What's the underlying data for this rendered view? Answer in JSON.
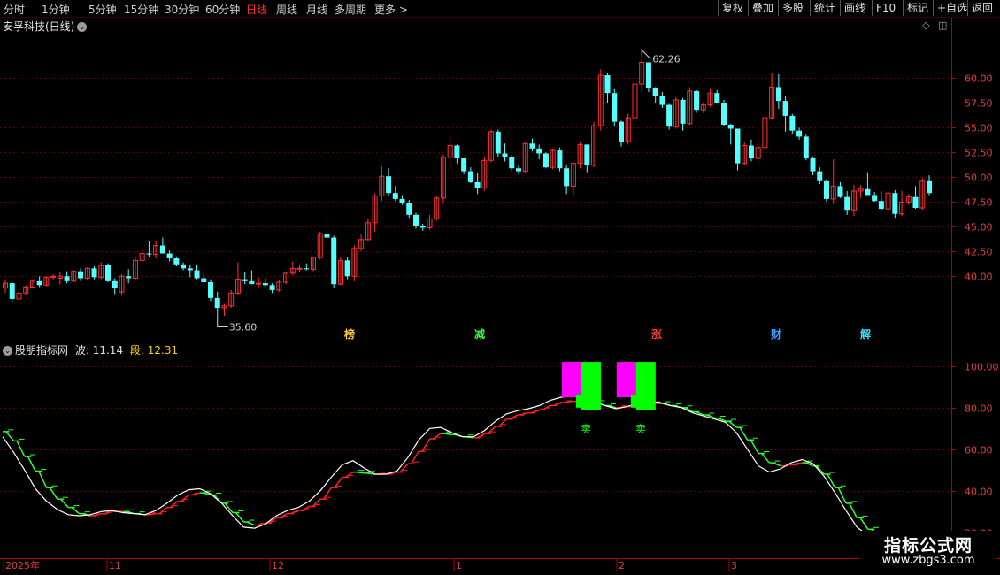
{
  "toolbar": {
    "timeframes": [
      "分时",
      "1分钟",
      "5分钟",
      "15分钟",
      "30分钟",
      "60分钟",
      "日线",
      "周线",
      "月线",
      "多周期",
      "更多 >"
    ],
    "active_timeframe": "日线",
    "right_buttons": [
      "复权",
      "叠加",
      "多股",
      "统计",
      "画线",
      "F10",
      "标记",
      "+自选",
      "返回"
    ]
  },
  "main_chart": {
    "title": "安孚科技(日线)",
    "high_label": "62.26",
    "low_label": "35.60",
    "events": [
      {
        "text": "榜",
        "color": "#ffd040"
      },
      {
        "text": "减",
        "color": "#40ff40"
      },
      {
        "text": "涨",
        "color": "#ff4040"
      },
      {
        "text": "财",
        "color": "#40a0ff"
      },
      {
        "text": "解",
        "color": "#40e0ff"
      }
    ]
  },
  "sub_chart": {
    "name": "股朋指标网",
    "wave_label": "波:",
    "wave_value": "11.14",
    "seg_label": "段:",
    "seg_value": "12.31",
    "sell_label": "卖"
  },
  "x_axis": [
    "2025年",
    "11",
    "12",
    "1",
    "2",
    "3"
  ],
  "watermark": {
    "line1": "指标公式网",
    "line2": "www.zbgs3.com"
  },
  "colors": {
    "up": "#ff3232",
    "down": "#54ffff",
    "grid": "#5a0000",
    "axis": "#b00000",
    "wave": "#ffffff",
    "seg_up": "#ff2020",
    "seg_down": "#30ff30",
    "sell_green": "#00ff00",
    "sell_magenta": "#ff00ff"
  },
  "chart_data": [
    {
      "type": "candlestick",
      "title": "安孚科技(日线)",
      "ylim": [
        33.5,
        64.5
      ],
      "yticks": [
        40.0,
        42.5,
        45.0,
        47.5,
        50.0,
        52.5,
        55.0,
        57.5,
        60.0
      ],
      "ohlc": [
        [
          38.8,
          39.6,
          38.3,
          39.3
        ],
        [
          39.3,
          39.4,
          37.4,
          37.7
        ],
        [
          37.7,
          38.6,
          37.5,
          38.3
        ],
        [
          38.3,
          39.1,
          38.1,
          38.9
        ],
        [
          38.9,
          39.6,
          38.8,
          39.5
        ],
        [
          39.5,
          40.0,
          38.9,
          39.1
        ],
        [
          39.1,
          40.0,
          39.0,
          39.9
        ],
        [
          39.9,
          40.2,
          39.6,
          40.0
        ],
        [
          39.8,
          40.4,
          39.2,
          40.0
        ],
        [
          40.0,
          40.5,
          39.3,
          39.5
        ],
        [
          39.5,
          40.6,
          39.4,
          40.5
        ],
        [
          40.5,
          40.8,
          39.5,
          39.8
        ],
        [
          39.8,
          40.9,
          39.6,
          40.8
        ],
        [
          40.8,
          41.0,
          39.7,
          39.9
        ],
        [
          39.9,
          41.4,
          39.7,
          41.1
        ],
        [
          41.1,
          41.3,
          39.4,
          39.5
        ],
        [
          39.5,
          39.8,
          38.2,
          38.8
        ],
        [
          38.4,
          40.2,
          38.1,
          40.0
        ],
        [
          40.0,
          40.7,
          39.3,
          39.8
        ],
        [
          39.8,
          41.9,
          39.6,
          41.6
        ],
        [
          41.6,
          42.7,
          41.4,
          42.3
        ],
        [
          42.3,
          43.6,
          41.9,
          42.2
        ],
        [
          42.2,
          43.6,
          41.8,
          43.1
        ],
        [
          43.1,
          43.9,
          42.7,
          42.3
        ],
        [
          42.3,
          42.6,
          41.5,
          41.8
        ],
        [
          41.8,
          42.0,
          41.0,
          41.2
        ],
        [
          41.2,
          41.4,
          40.6,
          40.8
        ],
        [
          40.8,
          41.2,
          39.9,
          40.6
        ],
        [
          40.6,
          41.2,
          39.7,
          39.8
        ],
        [
          39.8,
          40.3,
          39.3,
          39.4
        ],
        [
          39.4,
          39.7,
          37.5,
          37.8
        ],
        [
          37.8,
          38.4,
          35.6,
          36.8
        ],
        [
          36.8,
          37.2,
          36.0,
          37.0
        ],
        [
          37.0,
          38.6,
          36.8,
          38.3
        ],
        [
          38.3,
          41.4,
          38.1,
          39.7
        ],
        [
          39.7,
          40.4,
          39.2,
          39.5
        ],
        [
          39.5,
          40.6,
          39.3,
          39.2
        ],
        [
          39.2,
          39.9,
          38.9,
          39.3
        ],
        [
          39.3,
          39.8,
          39.0,
          39.1
        ],
        [
          39.1,
          39.3,
          38.3,
          38.6
        ],
        [
          38.6,
          39.6,
          38.4,
          39.4
        ],
        [
          39.4,
          40.5,
          39.2,
          40.3
        ],
        [
          40.3,
          41.5,
          40.1,
          40.8
        ],
        [
          40.8,
          41.1,
          40.4,
          40.8
        ],
        [
          40.8,
          41.3,
          40.6,
          40.7
        ],
        [
          40.7,
          42.0,
          40.5,
          41.9
        ],
        [
          41.9,
          44.5,
          41.7,
          44.3
        ],
        [
          44.3,
          46.5,
          42.4,
          43.9
        ],
        [
          43.9,
          44.1,
          38.8,
          39.2
        ],
        [
          39.2,
          42.0,
          39.1,
          41.6
        ],
        [
          41.6,
          41.9,
          39.7,
          40.0
        ],
        [
          40.0,
          43.1,
          39.5,
          42.8
        ],
        [
          42.8,
          44.2,
          42.5,
          43.7
        ],
        [
          43.7,
          45.8,
          43.6,
          45.4
        ],
        [
          45.4,
          48.4,
          44.5,
          48.1
        ],
        [
          48.1,
          51.1,
          47.6,
          50.1
        ],
        [
          50.1,
          50.9,
          48.1,
          48.4
        ],
        [
          48.4,
          49.1,
          47.6,
          47.8
        ],
        [
          47.8,
          48.2,
          47.2,
          47.4
        ],
        [
          47.4,
          47.7,
          45.9,
          46.2
        ],
        [
          46.2,
          46.4,
          44.8,
          45.1
        ],
        [
          45.1,
          45.3,
          44.6,
          44.9
        ],
        [
          44.9,
          46.2,
          44.7,
          45.8
        ],
        [
          45.8,
          48.1,
          45.6,
          47.9
        ],
        [
          47.9,
          52.3,
          47.4,
          52.0
        ],
        [
          52.0,
          54.2,
          50.8,
          53.2
        ],
        [
          53.2,
          53.3,
          51.4,
          51.9
        ],
        [
          51.9,
          51.9,
          50.3,
          50.6
        ],
        [
          50.6,
          51.0,
          49.4,
          49.5
        ],
        [
          49.5,
          50.4,
          48.3,
          48.9
        ],
        [
          48.9,
          52.1,
          48.6,
          51.7
        ],
        [
          51.7,
          54.8,
          51.5,
          54.6
        ],
        [
          54.6,
          54.8,
          52.0,
          52.4
        ],
        [
          52.4,
          53.4,
          51.6,
          52.0
        ],
        [
          52.0,
          52.3,
          50.6,
          50.9
        ],
        [
          50.9,
          51.2,
          50.3,
          50.6
        ],
        [
          50.6,
          53.5,
          50.4,
          53.4
        ],
        [
          53.4,
          53.9,
          52.6,
          52.9
        ],
        [
          52.9,
          53.3,
          51.8,
          52.4
        ],
        [
          52.4,
          52.5,
          50.9,
          51.0
        ],
        [
          51.0,
          52.8,
          50.8,
          52.7
        ],
        [
          52.7,
          53.0,
          50.6,
          50.9
        ],
        [
          50.9,
          51.3,
          48.3,
          49.1
        ],
        [
          49.1,
          51.5,
          48.2,
          51.4
        ],
        [
          51.4,
          53.6,
          50.9,
          53.3
        ],
        [
          53.3,
          52.8,
          50.5,
          51.2
        ],
        [
          51.2,
          55.6,
          51.0,
          55.2
        ],
        [
          55.2,
          60.9,
          54.7,
          60.3
        ],
        [
          60.3,
          60.5,
          57.5,
          58.5
        ],
        [
          58.5,
          58.9,
          55.1,
          55.6
        ],
        [
          55.6,
          55.7,
          53.1,
          53.6
        ],
        [
          53.6,
          56.4,
          53.3,
          56.0
        ],
        [
          56.0,
          59.6,
          55.8,
          59.4
        ],
        [
          59.4,
          62.3,
          58.6,
          61.6
        ],
        [
          61.6,
          59.9,
          58.6,
          59.0
        ],
        [
          59.0,
          59.1,
          57.5,
          58.2
        ],
        [
          58.2,
          58.6,
          57.0,
          57.3
        ],
        [
          57.3,
          57.4,
          54.8,
          55.1
        ],
        [
          55.1,
          58.1,
          54.9,
          57.8
        ],
        [
          57.8,
          58.0,
          54.7,
          55.4
        ],
        [
          55.4,
          59.1,
          55.3,
          58.7
        ],
        [
          58.7,
          58.8,
          56.5,
          56.8
        ],
        [
          56.8,
          57.5,
          56.5,
          57.3
        ],
        [
          57.3,
          58.9,
          57.1,
          58.5
        ],
        [
          58.5,
          58.8,
          57.9,
          57.5
        ],
        [
          57.5,
          57.8,
          55.2,
          55.3
        ],
        [
          55.3,
          55.4,
          53.3,
          54.9
        ],
        [
          54.9,
          54.8,
          50.7,
          51.4
        ],
        [
          51.4,
          53.5,
          51.2,
          53.2
        ],
        [
          53.2,
          53.8,
          51.6,
          51.9
        ],
        [
          51.9,
          53.7,
          51.4,
          53.0
        ],
        [
          53.0,
          56.3,
          52.9,
          56.0
        ],
        [
          56.0,
          60.5,
          55.8,
          59.1
        ],
        [
          59.1,
          60.4,
          56.9,
          57.7
        ],
        [
          57.7,
          58.2,
          54.6,
          56.2
        ],
        [
          56.2,
          56.4,
          54.4,
          54.7
        ],
        [
          54.7,
          55.0,
          53.8,
          54.1
        ],
        [
          54.1,
          54.3,
          51.7,
          51.9
        ],
        [
          51.9,
          52.1,
          50.2,
          50.6
        ],
        [
          50.6,
          51.0,
          49.3,
          49.6
        ],
        [
          49.6,
          49.8,
          47.5,
          47.8
        ],
        [
          47.8,
          51.8,
          47.3,
          49.1
        ],
        [
          49.1,
          49.5,
          47.9,
          48.0
        ],
        [
          48.0,
          48.6,
          46.2,
          46.7
        ],
        [
          46.7,
          49.2,
          46.1,
          48.6
        ],
        [
          48.6,
          49.2,
          47.9,
          48.8
        ],
        [
          48.8,
          50.5,
          48.2,
          48.2
        ],
        [
          48.2,
          48.5,
          47.5,
          47.6
        ],
        [
          47.6,
          48.6,
          46.7,
          46.8
        ],
        [
          46.8,
          48.6,
          46.5,
          48.4
        ],
        [
          48.4,
          48.7,
          45.9,
          46.3
        ],
        [
          46.3,
          48.6,
          46.1,
          47.5
        ],
        [
          47.5,
          48.3,
          47.2,
          48.0
        ],
        [
          48.0,
          49.1,
          46.8,
          46.9
        ],
        [
          46.9,
          49.9,
          46.7,
          49.6
        ],
        [
          49.6,
          50.2,
          48.2,
          48.4
        ]
      ]
    },
    {
      "type": "line",
      "title": "股朋指标网",
      "ylim": [
        8,
        108
      ],
      "yticks": [
        20.0,
        40.0,
        60.0,
        80.0,
        100.0
      ],
      "series": [
        {
          "name": "波",
          "values": [
            66.0,
            58.5,
            50.0,
            41.0,
            35.0,
            31.0,
            28.5,
            28.0,
            28.5,
            30.0,
            30.5,
            29.5,
            29.0,
            28.5,
            30.5,
            34.0,
            38.0,
            40.5,
            41.0,
            38.5,
            34.0,
            28.0,
            22.5,
            22.0,
            24.0,
            28.0,
            30.5,
            32.0,
            35.0,
            40.0,
            46.5,
            52.5,
            54.5,
            51.0,
            48.0,
            48.0,
            49.5,
            56.0,
            64.5,
            70.0,
            70.5,
            68.0,
            66.0,
            66.0,
            69.0,
            73.5,
            77.0,
            78.5,
            79.5,
            81.0,
            83.5,
            85.0,
            85.5,
            84.5,
            83.0,
            81.0,
            79.5,
            80.5,
            82.0,
            83.0,
            82.5,
            81.0,
            80.0,
            77.5,
            76.0,
            74.5,
            73.0,
            68.0,
            60.0,
            52.0,
            49.0,
            50.5,
            53.5,
            55.0,
            53.0,
            47.0,
            39.0,
            30.5,
            22.5,
            18.5,
            16.0,
            14.0,
            13.0,
            12.5,
            12.0,
            11.14
          ]
        },
        {
          "name": "段",
          "values": [
            68.5,
            64.0,
            56.5,
            49.5,
            41.5,
            36.0,
            32.0,
            29.0,
            28.0,
            29.0,
            30.0,
            30.0,
            29.0,
            28.5,
            29.0,
            32.0,
            35.0,
            38.0,
            39.0,
            38.0,
            34.0,
            29.5,
            25.0,
            23.5,
            24.5,
            27.0,
            29.0,
            30.5,
            32.5,
            36.0,
            41.5,
            46.5,
            49.0,
            48.5,
            48.0,
            48.0,
            49.0,
            53.0,
            59.0,
            65.0,
            67.5,
            67.0,
            66.0,
            65.5,
            67.5,
            71.0,
            74.5,
            76.5,
            77.5,
            79.0,
            81.0,
            82.5,
            83.0,
            83.0,
            82.5,
            81.0,
            80.0,
            80.5,
            81.5,
            82.0,
            82.0,
            81.0,
            80.0,
            78.0,
            76.5,
            75.0,
            73.5,
            70.5,
            64.5,
            58.0,
            53.5,
            52.0,
            52.5,
            53.5,
            52.0,
            48.0,
            41.5,
            34.0,
            27.0,
            21.5,
            18.5,
            16.5,
            15.0,
            14.0,
            13.0,
            12.31
          ]
        }
      ]
    }
  ]
}
